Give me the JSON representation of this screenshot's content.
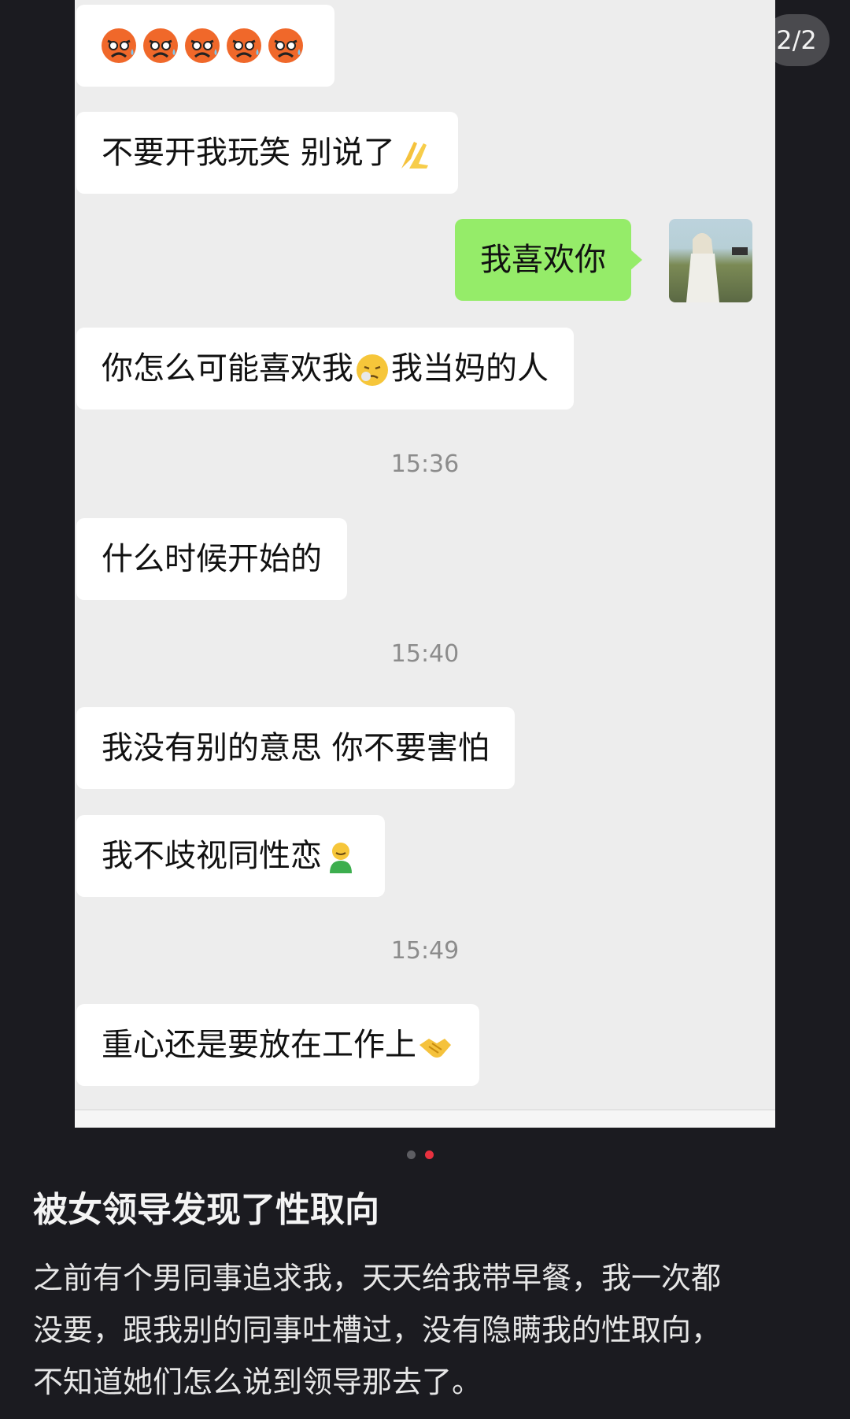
{
  "page_indicator": "2/2",
  "chat": {
    "messages": [
      {
        "side": "left",
        "text": "",
        "emoji": [
          "crying-angry-face",
          "crying-angry-face",
          "crying-angry-face",
          "crying-angry-face",
          "crying-angry-face"
        ]
      },
      {
        "side": "left",
        "text": "不要开我玩笑 别说了",
        "emoji_after": "folded-hands"
      },
      {
        "side": "right",
        "text": "我喜欢你"
      },
      {
        "side": "left",
        "text_before": "你怎么可能喜欢我",
        "emoji_mid": "worried-face",
        "text_after": "我当妈的人"
      },
      {
        "type": "time",
        "text": "15:36"
      },
      {
        "side": "left",
        "text": "什么时候开始的"
      },
      {
        "type": "time",
        "text": "15:40"
      },
      {
        "side": "left",
        "text": "我没有别的意思 你不要害怕"
      },
      {
        "side": "left",
        "text": "我不歧视同性恋",
        "emoji_after": "smiley-green-person"
      },
      {
        "type": "time",
        "text": "15:49"
      },
      {
        "side": "left",
        "text": "重心还是要放在工作上",
        "emoji_after": "handshake"
      }
    ]
  },
  "carousel": {
    "count": 2,
    "active": 2
  },
  "post": {
    "title": "被女领导发现了性取向",
    "body_lines": [
      "之前有个男同事追求我，天天给我带早餐，我一次都",
      "没要，跟我别的同事吐槽过，没有隐瞒我的性取向，",
      "不知道她们怎么说到领导那去了。"
    ]
  },
  "colors": {
    "sent_bubble": "#95ec69",
    "received_bubble": "#ffffff",
    "chat_bg": "#ededed",
    "page_bg": "#1b1b20",
    "active_dot": "#e8313f"
  }
}
